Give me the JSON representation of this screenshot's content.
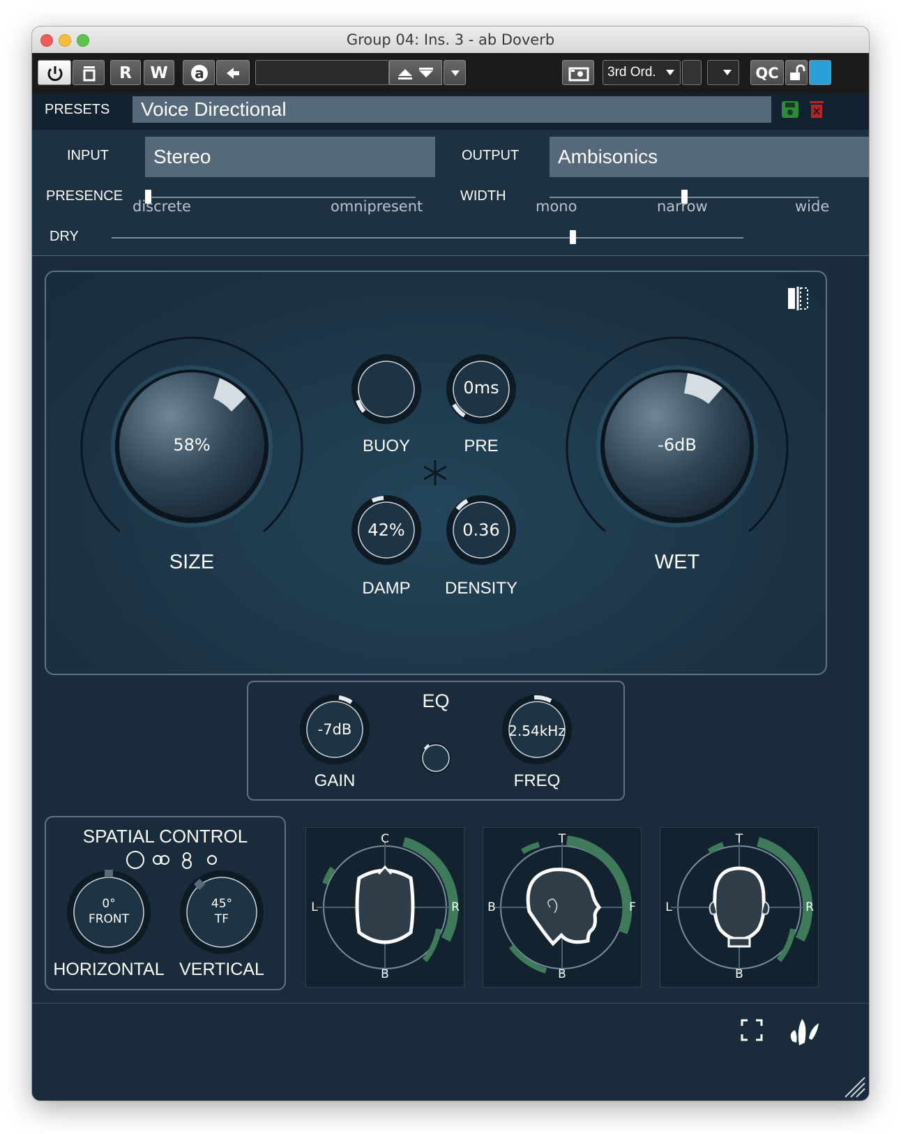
{
  "window": {
    "title": "Group 04: Ins. 3 - ab Doverb"
  },
  "toolbar": {
    "read_label": "R",
    "write_label": "W",
    "a_label": "a",
    "order_label": "3rd Ord.",
    "qc_label": "QC"
  },
  "presets": {
    "label": "PRESETS",
    "value": "Voice Directional"
  },
  "io": {
    "input_label": "INPUT",
    "input_value": "Stereo",
    "output_label": "OUTPUT",
    "output_value": "Ambisonics"
  },
  "presence": {
    "label": "PRESENCE",
    "min_label": "discrete",
    "max_label": "omnipresent",
    "value": 0.0
  },
  "width": {
    "label": "WIDTH",
    "mono_label": "mono",
    "narrow_label": "narrow",
    "wide_label": "wide",
    "value": 0.5
  },
  "dry": {
    "label": "DRY",
    "value": 0.73
  },
  "knobs": {
    "size": {
      "label": "SIZE",
      "value": "58%"
    },
    "wet": {
      "label": "WET",
      "value": "-6dB"
    },
    "buoy": {
      "label": "BUOY",
      "value": ""
    },
    "pre": {
      "label": "PRE",
      "value": "0ms"
    },
    "damp": {
      "label": "DAMP",
      "value": "42%"
    },
    "density": {
      "label": "DENSITY",
      "value": "0.36"
    }
  },
  "eq": {
    "title": "EQ",
    "gain": {
      "label": "GAIN",
      "value": "-7dB"
    },
    "freq": {
      "label": "FREQ",
      "value": "2.54kHz"
    }
  },
  "spatial": {
    "title": "SPATIAL CONTROL",
    "horizontal": {
      "label": "HORIZONTAL",
      "value_line1": "0°",
      "value_line2": "FRONT"
    },
    "vertical": {
      "label": "VERTICAL",
      "value_line1": "45°",
      "value_line2": "TF"
    }
  },
  "views": {
    "top": {
      "t": "C",
      "l": "L",
      "r": "R",
      "b": "B"
    },
    "side": {
      "t": "T",
      "l": "B",
      "r": "F",
      "b": "B"
    },
    "front": {
      "t": "T",
      "l": "L",
      "r": "R",
      "b": "B"
    }
  },
  "colors": {
    "accent_green": "#3f7a5a",
    "panel_bg": "#1d3142",
    "field_bg": "#56697a"
  }
}
